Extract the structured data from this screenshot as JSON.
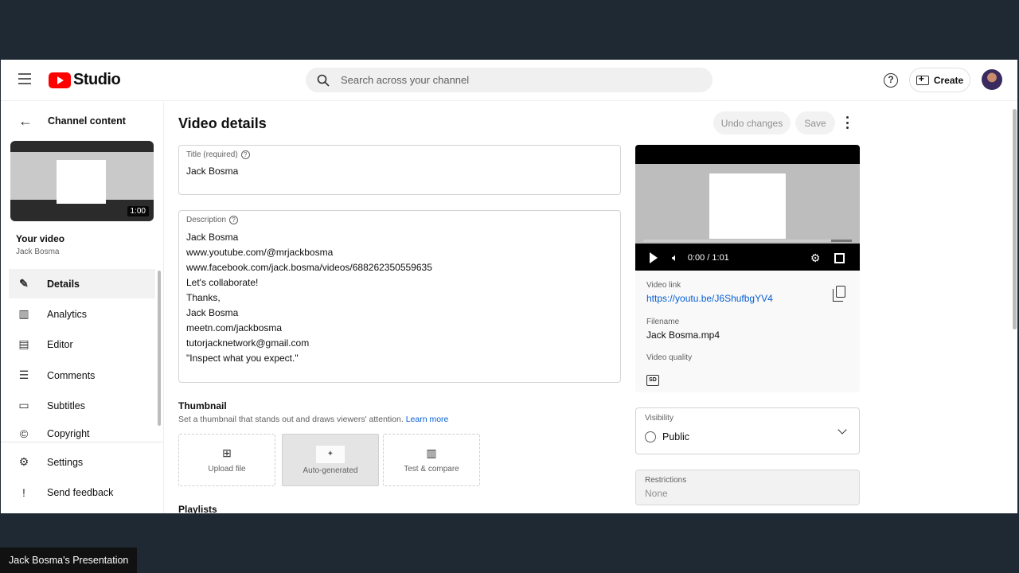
{
  "header": {
    "logo_text": "Studio",
    "search_placeholder": "Search across your channel",
    "create_label": "Create"
  },
  "sidebar": {
    "back_label": "Channel content",
    "thumbnail_duration": "1:00",
    "your_video_label": "Your video",
    "channel_name": "Jack Bosma",
    "items": [
      {
        "label": "Details",
        "icon": "pencil-icon",
        "active": true
      },
      {
        "label": "Analytics",
        "icon": "analytics-icon"
      },
      {
        "label": "Editor",
        "icon": "editor-icon"
      },
      {
        "label": "Comments",
        "icon": "comments-icon"
      },
      {
        "label": "Subtitles",
        "icon": "subtitles-icon"
      },
      {
        "label": "Copyright",
        "icon": "copyright-icon"
      }
    ],
    "bottom_items": [
      {
        "label": "Settings",
        "icon": "gear-icon"
      },
      {
        "label": "Send feedback",
        "icon": "feedback-icon"
      }
    ]
  },
  "main": {
    "title": "Video details",
    "undo_label": "Undo changes",
    "save_label": "Save",
    "title_field": {
      "label": "Title (required)",
      "value": "Jack Bosma"
    },
    "description_field": {
      "label": "Description",
      "lines": [
        "Jack Bosma",
        "www.youtube.com/@mrjackbosma",
        "www.facebook.com/jack.bosma/videos/688262350559635",
        "Let's collaborate!",
        "Thanks,",
        "Jack Bosma",
        "meetn.com/jackbosma",
        "tutorjacknetwork@gmail.com",
        "\"Inspect what you expect.\""
      ]
    },
    "thumbnail": {
      "title": "Thumbnail",
      "subtitle": "Set a thumbnail that stands out and draws viewers' attention.",
      "learn_more": "Learn more",
      "options": [
        "Upload file",
        "Auto-generated",
        "Test & compare"
      ]
    },
    "playlists_label": "Playlists"
  },
  "right_panel": {
    "player_time": "0:00 / 1:01",
    "video_link_label": "Video link",
    "video_link": "https://youtu.be/J6ShufbgYV4",
    "filename_label": "Filename",
    "filename": "Jack Bosma.mp4",
    "quality_label": "Video quality",
    "quality_badge": "SD",
    "visibility_label": "Visibility",
    "visibility_value": "Public",
    "restrictions_label": "Restrictions",
    "restrictions_value": "None"
  },
  "presenter_label": "Jack Bosma's Presentation",
  "colors": {
    "accent": "#065fd4",
    "brand": "#ff0000"
  }
}
